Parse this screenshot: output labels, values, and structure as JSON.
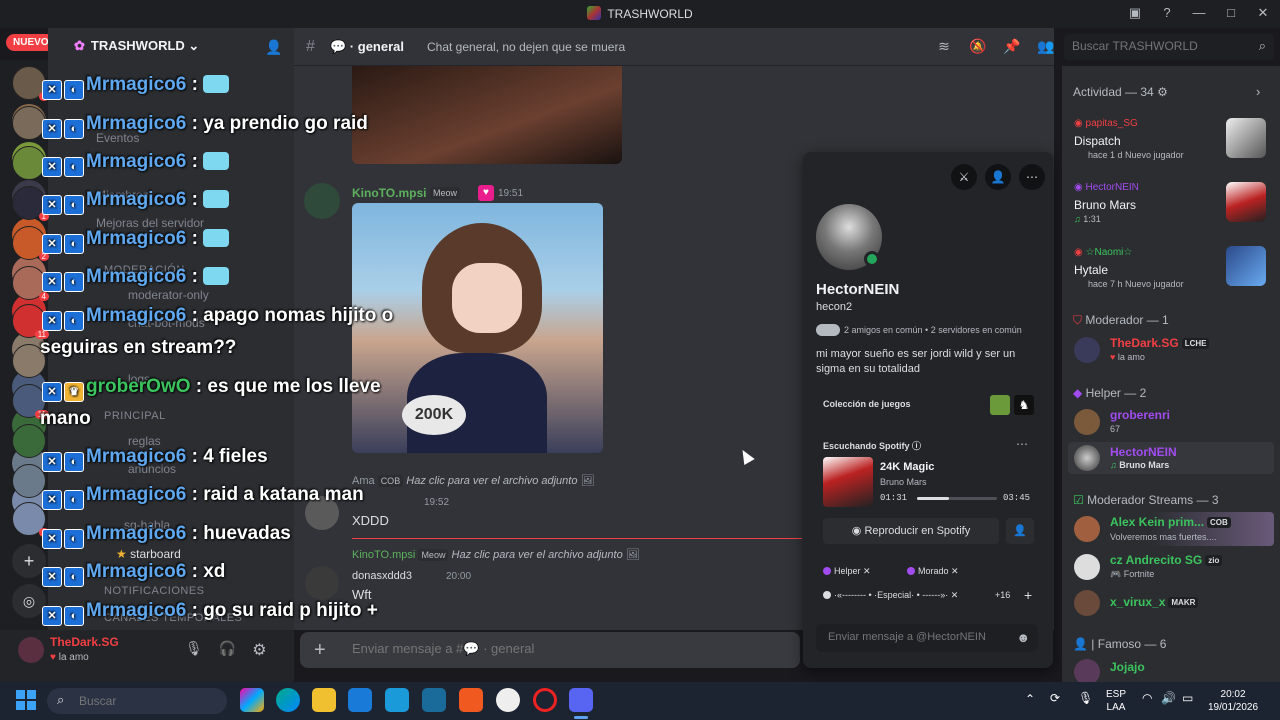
{
  "window": {
    "title": "TRASHWORLD"
  },
  "badge_new": "NUEVO",
  "server": {
    "name": "TRASHWORLD"
  },
  "channel": {
    "name": "general",
    "topic": "Chat general, no dejen que se muera"
  },
  "search": {
    "placeholder": "Buscar TRASHWORLD"
  },
  "sidebar_channels": [
    "Eventos",
    "Miembros",
    "Mejoras del servidor",
    "MODERACIÓN",
    "moderator-only",
    "chat-bot-mods",
    "logs",
    "PRINCIPAL",
    "reglas",
    "anuncios",
    "sg-habla",
    "starboard",
    "NOTIFICACIONES",
    "CANALES TEMPORALES"
  ],
  "messages": {
    "m1": {
      "author": "KinoTO.mpsi",
      "tag": "Meow",
      "time": "19:51"
    },
    "reply1": {
      "author": "Ama",
      "tag": "COB",
      "text": "Haz clic para ver el archivo adjunto"
    },
    "m2": {
      "author": "",
      "time": "19:52",
      "text": "XDDD"
    },
    "reply2": {
      "author": "KinoTO.mpsi",
      "tag": "Meow",
      "text": "Haz clic para ver el archivo adjunto"
    },
    "m3": {
      "author": "donasxddd3",
      "time": "20:00",
      "text": "Wft"
    },
    "image_label": "200K"
  },
  "composer": {
    "placeholder": "Enviar mensaje a #💬 · general"
  },
  "user_panel": {
    "name": "TheDark.SG",
    "status": "la amo"
  },
  "overlay": [
    {
      "name": "Mrmagico6",
      "text": ":"
    },
    {
      "name": "Mrmagico6",
      "text": ": ya prendio go raid"
    },
    {
      "name": "Mrmagico6",
      "text": ":"
    },
    {
      "name": "Mrmagico6",
      "text": ":"
    },
    {
      "name": "Mrmagico6",
      "text": ":"
    },
    {
      "name": "Mrmagico6",
      "text": ":"
    },
    {
      "name": "Mrmagico6",
      "text": ": apago nomas hijito o"
    },
    {
      "name": "",
      "text": "seguiras en stream??"
    },
    {
      "name": "groberOwO",
      "text": ": es que me los lleve"
    },
    {
      "name": "",
      "text": "mano"
    },
    {
      "name": "Mrmagico6",
      "text": ": 4 fieles"
    },
    {
      "name": "Mrmagico6",
      "text": ": raid a katana man"
    },
    {
      "name": "Mrmagico6",
      "text": ": huevadas"
    },
    {
      "name": "Mrmagico6",
      "text": ": xd"
    },
    {
      "name": "Mrmagico6",
      "text": ": go su raid p hijito +"
    }
  ],
  "profile": {
    "display_name": "HectorNEIN",
    "username": "hecon2",
    "mutual": "2 amigos en común  •  2 servidores en común",
    "bio": "mi mayor sueño es ser jordi wild y ser un sigma en su totalidad",
    "games_label": "Colección de juegos",
    "spotify_label": "Escuchando Spotify",
    "song": "24K Magic",
    "artist": "Bruno Mars",
    "time_elapsed": "01:31",
    "time_total": "03:45",
    "progress": 0.4,
    "play_button": "Reproducir en Spotify",
    "roles": [
      "Helper",
      "Morado",
      "·«-------- • ·Especial· • ------»·",
      "+16"
    ],
    "message_placeholder": "Enviar mensaje a @HectorNEIN"
  },
  "activity": {
    "header": "Actividad — 34",
    "items": [
      {
        "user": "papitas_SG",
        "title": "Dispatch",
        "meta": "hace 1 d   Nuevo jugador"
      },
      {
        "user": "HectorNEIN",
        "title": "Bruno Mars",
        "meta": "1:31"
      },
      {
        "user": "☆Naomi☆",
        "title": "Hytale",
        "meta": "hace 7 h   Nuevo jugador"
      }
    ]
  },
  "members": {
    "groups": [
      {
        "label": "Moderador — 1"
      },
      {
        "label": "Helper — 2"
      },
      {
        "label": "Moderador Streams — 3"
      },
      {
        "label": "| Famoso — 6"
      }
    ],
    "list": [
      {
        "name": "TheDark.SG",
        "sub": "la amo",
        "tag": "LCHE",
        "color": "#f23f43"
      },
      {
        "name": "groberenri",
        "sub": "67",
        "tag": "",
        "color": "#a24cf0"
      },
      {
        "name": "HectorNEIN",
        "sub": "Bruno Mars",
        "tag": "",
        "color": "#a24cf0"
      },
      {
        "name": "Alex Kein prim...",
        "sub": "Volveremos mas fuertes....",
        "tag": "COB",
        "color": "#3bc45d"
      },
      {
        "name": "cz Andrecito SG",
        "sub": "Fortnite",
        "tag": "zio",
        "color": "#3bc45d"
      },
      {
        "name": "x_virux_x",
        "sub": "",
        "tag": "MAKR",
        "color": "#3bc45d"
      },
      {
        "name": "Jojajo",
        "sub": "",
        "tag": "",
        "color": "#3bc45d"
      }
    ]
  },
  "taskbar": {
    "search_placeholder": "Buscar",
    "lang": "ESP",
    "lang2": "LAA",
    "time": "20:02",
    "date": "19/01/2026"
  }
}
